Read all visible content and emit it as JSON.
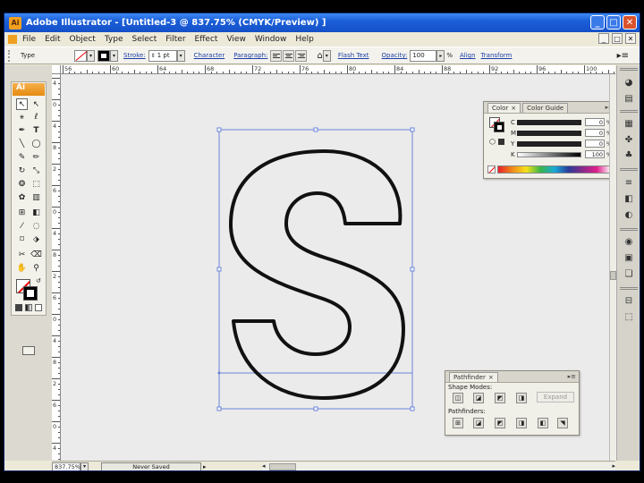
{
  "window": {
    "title": "Adobe Illustrator - [Untitled-3 @ 837.75% (CMYK/Preview) ]",
    "app_badge": "Ai",
    "minimize": "_",
    "maximize": "□",
    "close": "✕"
  },
  "menu": {
    "items": [
      "File",
      "Edit",
      "Object",
      "Type",
      "Select",
      "Filter",
      "Effect",
      "View",
      "Window",
      "Help"
    ]
  },
  "control": {
    "mode_label": "Type",
    "stroke_label": "Stroke:",
    "stroke_weight": "1 pt",
    "character_link": "Character",
    "paragraph_link": "Paragraph:",
    "flash_text_link": "Flash Text",
    "opacity_label": "Opacity:",
    "opacity_value": "100",
    "opacity_unit": "%",
    "align_link": "Align",
    "transform_link": "Transform"
  },
  "ruler": {
    "h_labels": [
      "56",
      "60",
      "64",
      "68",
      "72",
      "76",
      "80",
      "84",
      "88",
      "92",
      "96",
      "100"
    ],
    "v_labels": [
      "4",
      "0",
      "4",
      "8",
      "2",
      "6",
      "0",
      "4",
      "8",
      "2",
      "6",
      "0",
      "4",
      "8",
      "2",
      "6",
      "0",
      "4"
    ]
  },
  "tools": {
    "panel_label": "Ai"
  },
  "color_panel": {
    "tab_color": "Color",
    "tab_guide": "Color Guide",
    "tab_close": "×",
    "menu": "▸≡",
    "channels": [
      {
        "letter": "C",
        "value": "0",
        "unit": "%"
      },
      {
        "letter": "M",
        "value": "0",
        "unit": "%"
      },
      {
        "letter": "Y",
        "value": "0",
        "unit": "%"
      },
      {
        "letter": "K",
        "value": "100",
        "unit": "%"
      }
    ]
  },
  "pathfinder_panel": {
    "tab": "Pathfinder",
    "tab_close": "×",
    "shape_modes_label": "Shape Modes:",
    "expand_label": "Expand",
    "pathfinders_label": "Pathfinders:"
  },
  "artwork": {
    "glyph": "S"
  },
  "status": {
    "zoom": "837.75%",
    "saved_state": "Never Saved"
  },
  "colors": {
    "titlebar": "#1b5fd8",
    "canvas": "#ebebeb",
    "selection": "#6a86d8",
    "ai_orange": "#f0a020"
  }
}
